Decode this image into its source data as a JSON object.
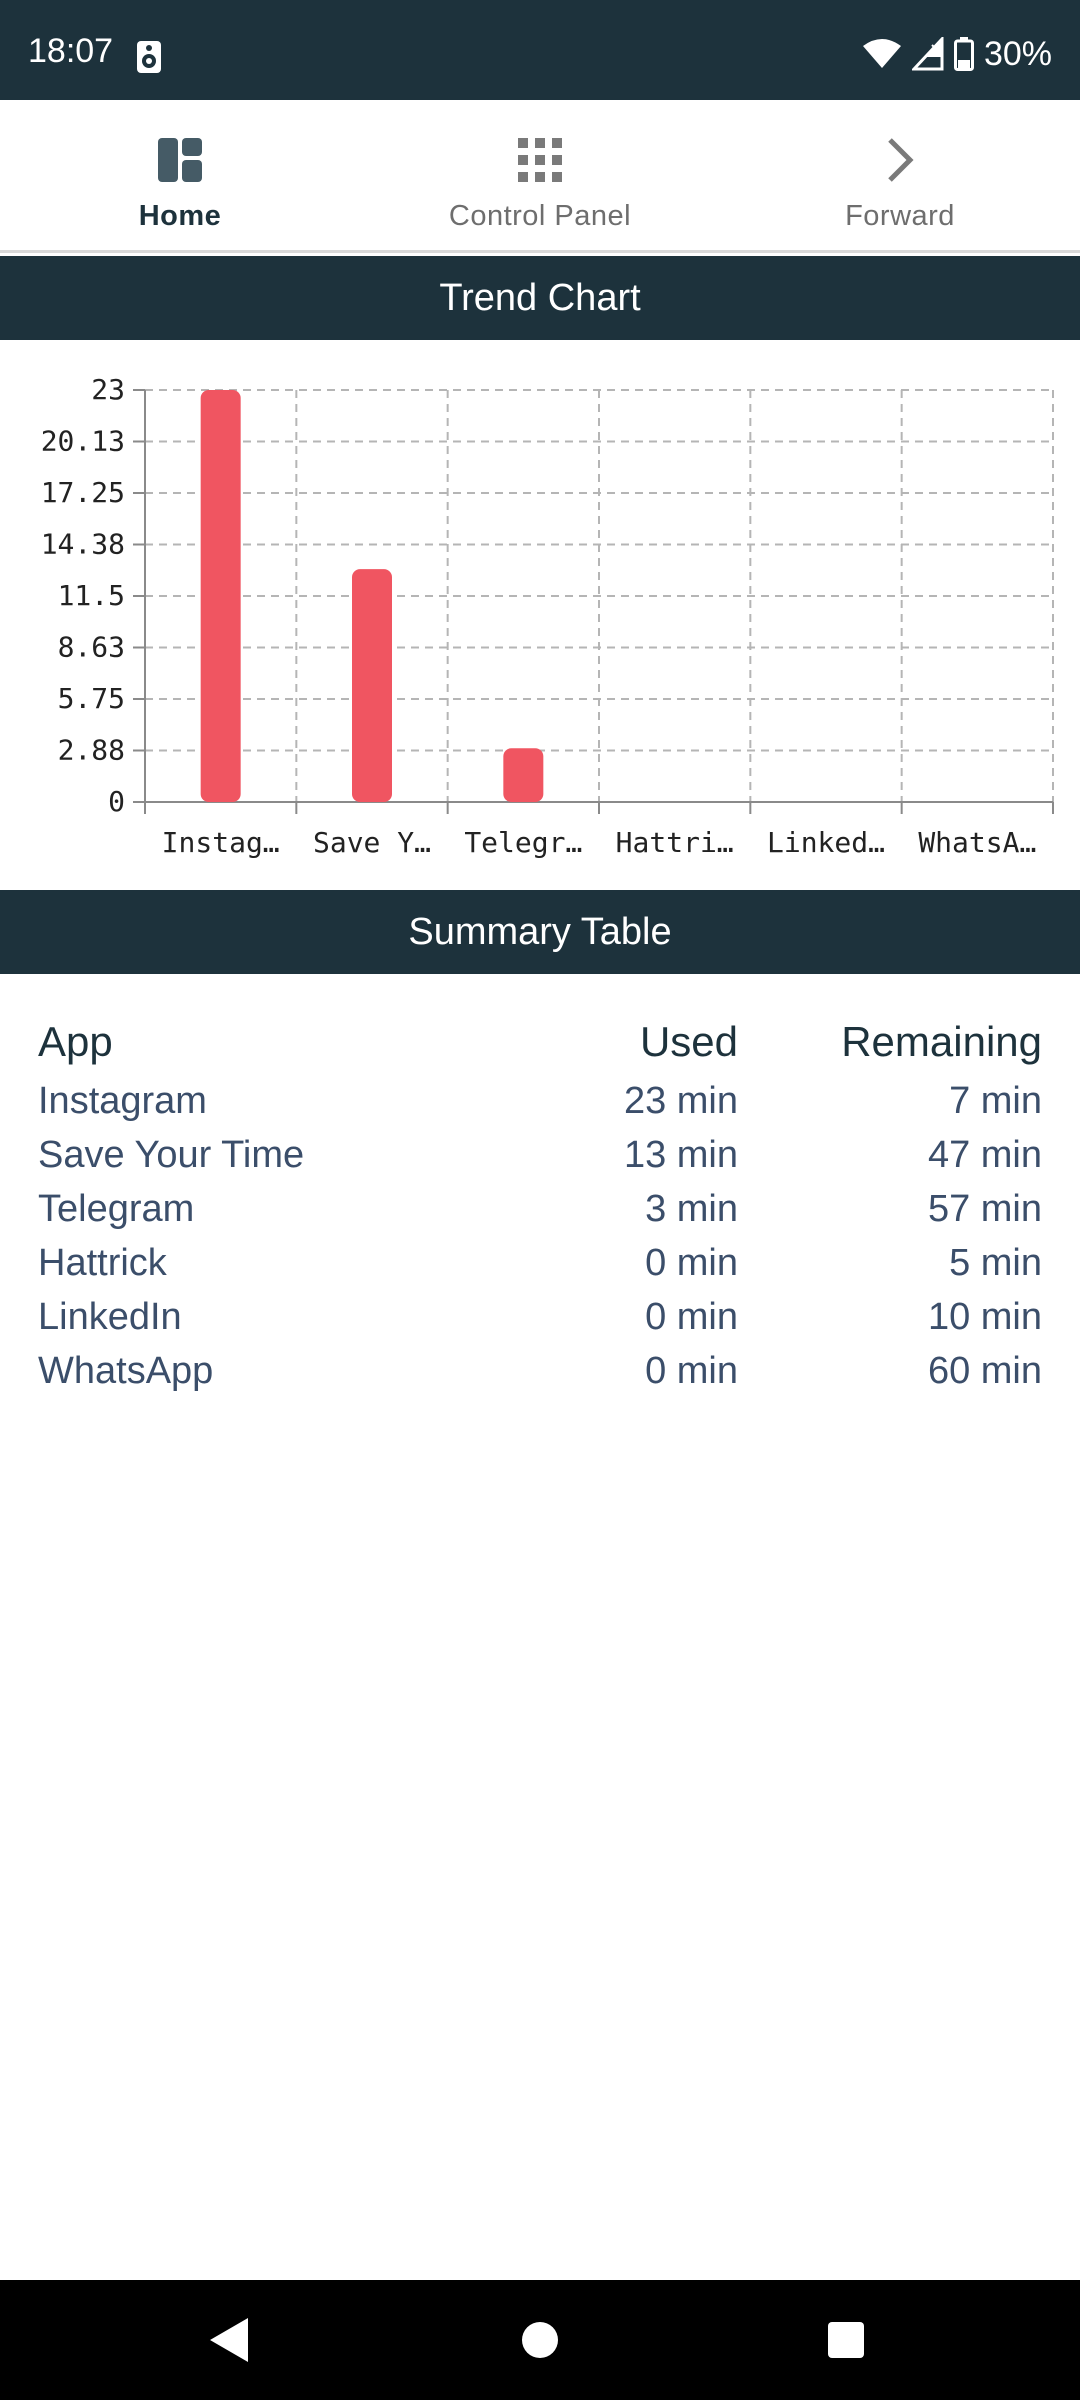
{
  "status_bar": {
    "time": "18:07",
    "battery": "30%"
  },
  "nav": {
    "items": [
      {
        "label": "Home",
        "icon": "dashboard-icon",
        "active": true
      },
      {
        "label": "Control Panel",
        "icon": "grid-icon",
        "active": false
      },
      {
        "label": "Forward",
        "icon": "chevron-right-icon",
        "active": false
      }
    ]
  },
  "trend_chart": {
    "header": "Trend Chart"
  },
  "chart_data": {
    "type": "bar",
    "categories": [
      "Instagram",
      "Save Your Time",
      "Telegram",
      "Hattrick",
      "LinkedIn",
      "WhatsApp"
    ],
    "category_labels": [
      "Instag…",
      "Save Y…",
      "Telegr…",
      "Hattri…",
      "Linked…",
      "WhatsA…"
    ],
    "values": [
      23,
      13,
      3,
      0,
      0,
      0
    ],
    "yticks": [
      "23",
      "20.13",
      "17.25",
      "14.38",
      "11.5",
      "8.63",
      "5.75",
      "2.88",
      "0"
    ],
    "ylim": [
      0,
      23
    ],
    "grid": true,
    "bar_color": "#f05561",
    "title": "",
    "xlabel": "",
    "ylabel": ""
  },
  "summary": {
    "header": "Summary Table",
    "columns": {
      "app": "App",
      "used": "Used",
      "remaining": "Remaining"
    },
    "rows": [
      {
        "app": "Instagram",
        "used": "23 min",
        "remaining": "7 min"
      },
      {
        "app": "Save Your Time",
        "used": "13 min",
        "remaining": "47 min"
      },
      {
        "app": "Telegram",
        "used": "3 min",
        "remaining": "57 min"
      },
      {
        "app": "Hattrick",
        "used": "0 min",
        "remaining": "5 min"
      },
      {
        "app": "LinkedIn",
        "used": "0 min",
        "remaining": "10 min"
      },
      {
        "app": "WhatsApp",
        "used": "0 min",
        "remaining": "60 min"
      }
    ]
  },
  "colors": {
    "header_bg": "#1d323c",
    "accent_bar": "#f05561"
  }
}
